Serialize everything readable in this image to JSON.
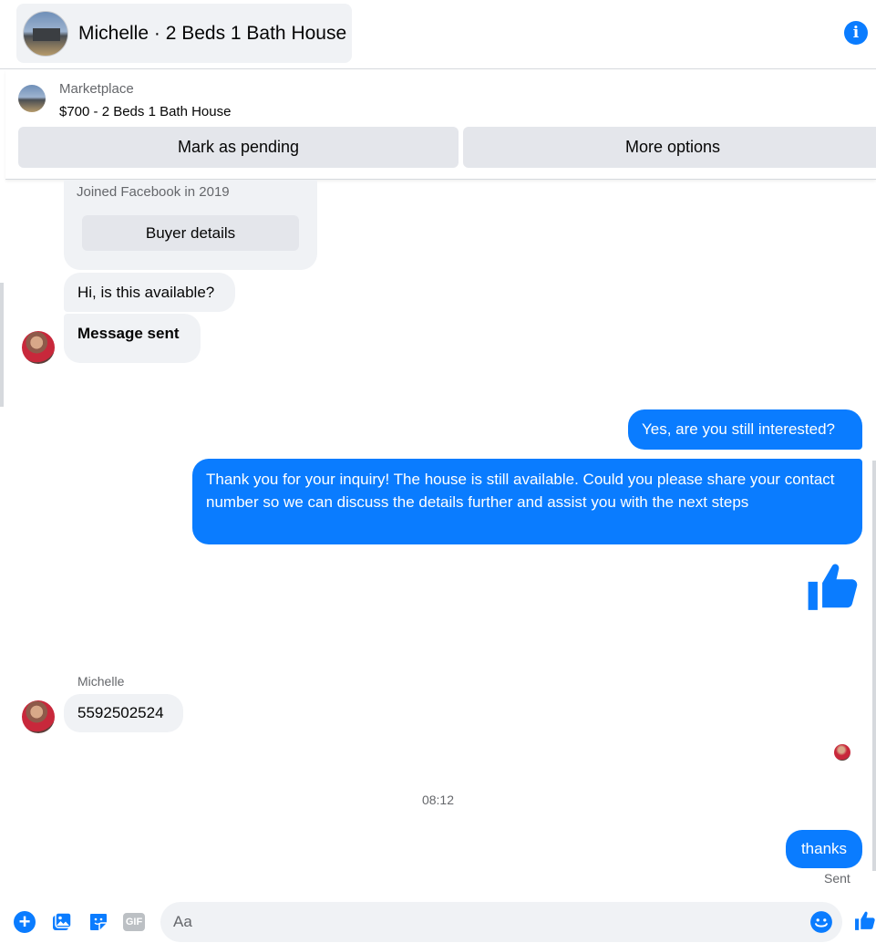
{
  "header": {
    "title": "Michelle · 2 Beds 1 Bath House",
    "icons": [
      "listing-avatar",
      "info-icon"
    ]
  },
  "marketplace": {
    "label": "Marketplace",
    "listing": "$700 - 2 Beds 1 Bath House",
    "pending_button": "Mark as pending",
    "more_button": "More options"
  },
  "buyer_card": {
    "joined": "Joined Facebook in 2019",
    "details_button": "Buyer details"
  },
  "messages": {
    "incoming_1": "Hi, is this available?",
    "incoming_2": "Message sent",
    "outgoing_1": "Yes, are you still interested?",
    "outgoing_2": "Thank you for your inquiry! The house is still available. Could you please share your contact number so we can discuss the details further and assist you with the next steps",
    "sender_name": "Michelle",
    "incoming_3": "5592502524",
    "timestamp": "08:12",
    "outgoing_3": "thanks",
    "status": "Sent"
  },
  "composer": {
    "placeholder": "Aa",
    "gif_label": "GIF",
    "icons": [
      "plus-icon",
      "photo-icon",
      "sticker-icon",
      "gif-icon",
      "emoji-icon",
      "like-icon"
    ]
  },
  "colors": {
    "accent": "#0a7cff",
    "bubble_in": "#f0f2f5",
    "secondary_text": "#65676b"
  }
}
